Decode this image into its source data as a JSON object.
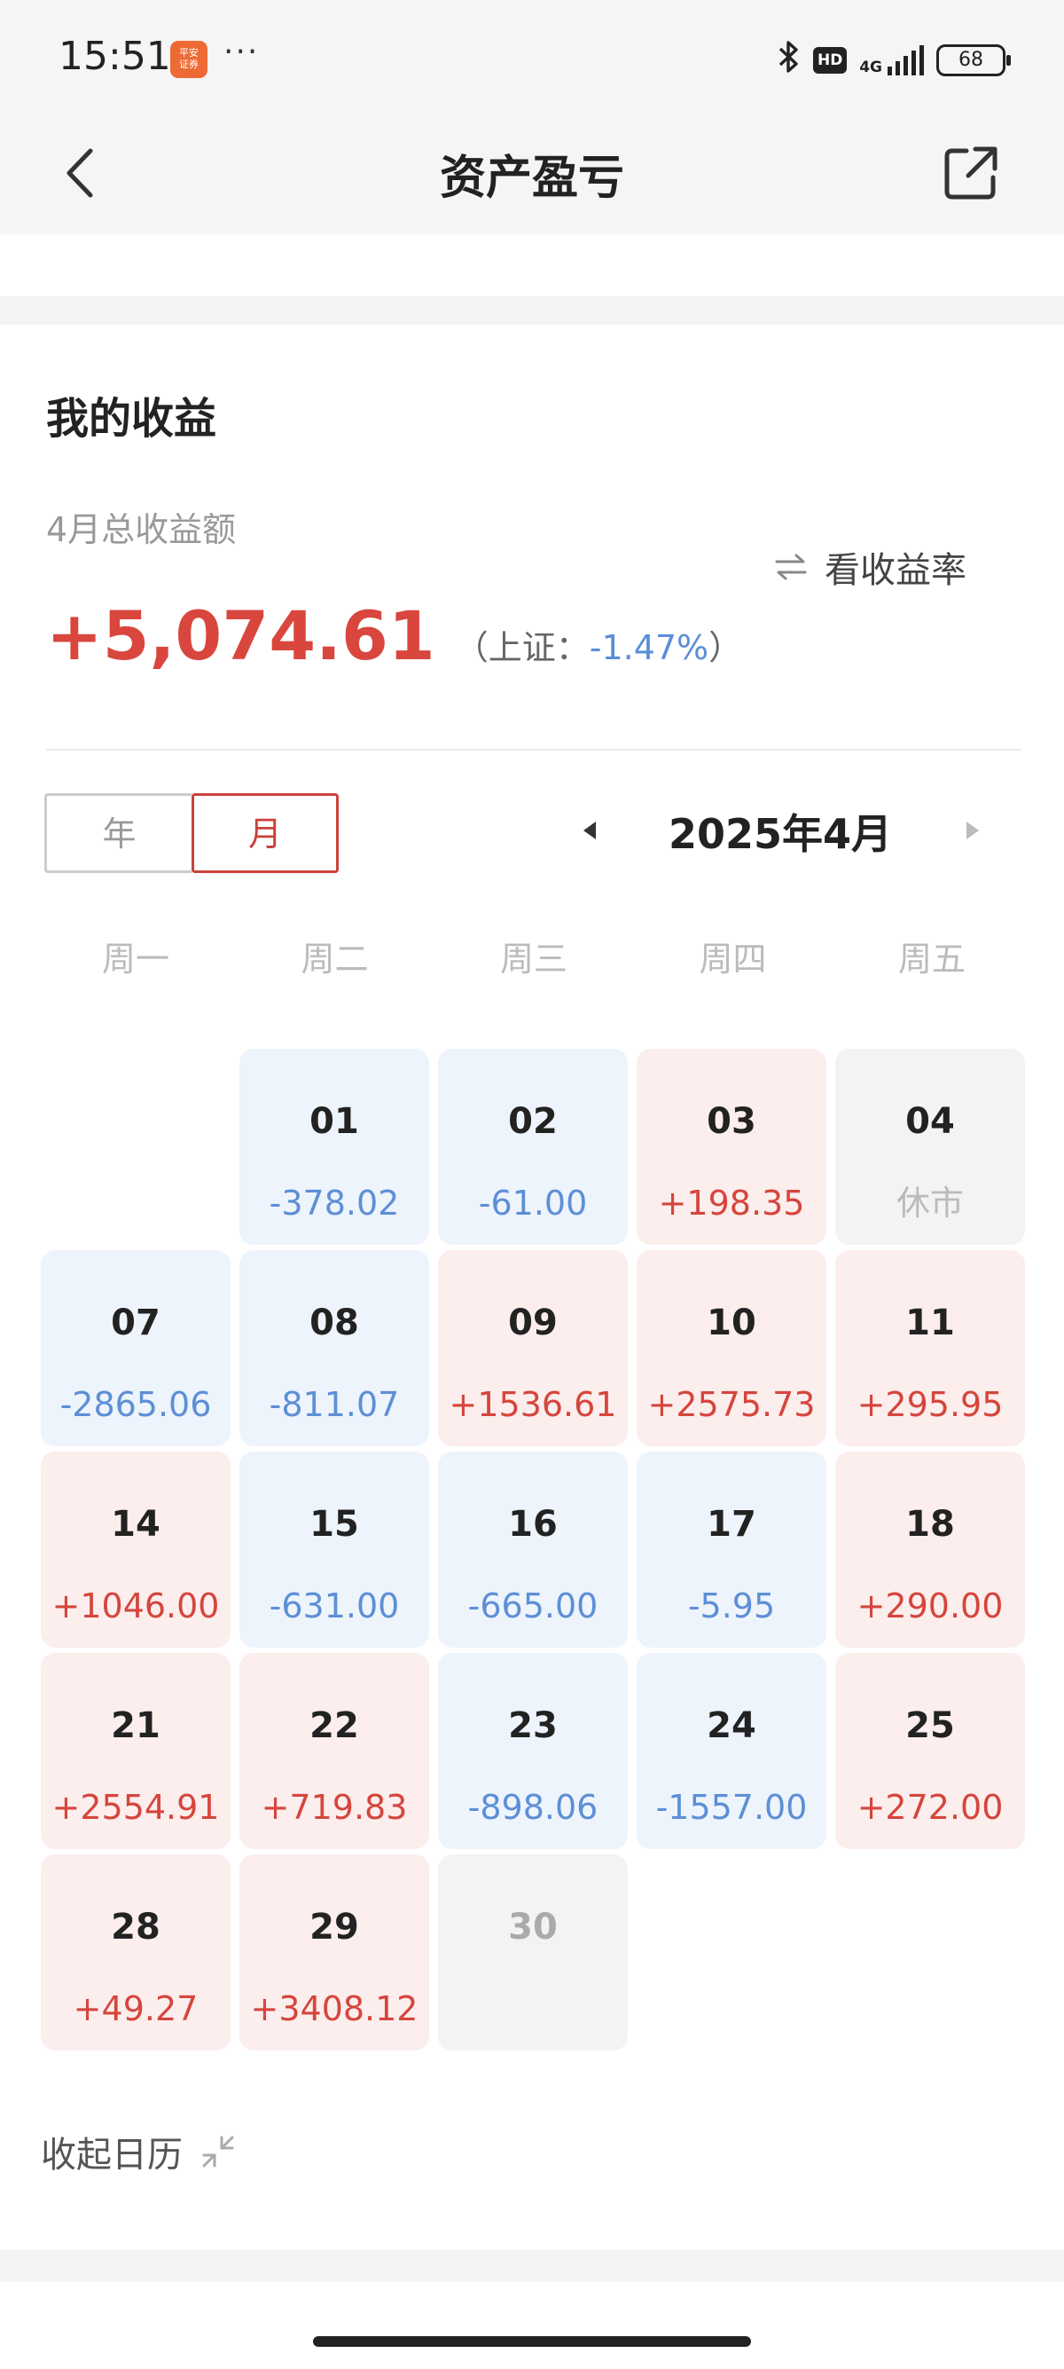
{
  "status_bar": {
    "time": "15:51",
    "app_badge_text": "平安证券",
    "more": "···",
    "bluetooth_icon": "bluetooth-icon",
    "hd_label": "HD",
    "network_label": "4G",
    "battery": "68"
  },
  "navbar": {
    "title": "资产盈亏",
    "back_icon": "chevron-left-icon",
    "share_icon": "share-external-icon"
  },
  "earnings": {
    "section_title": "我的收益",
    "total_label": "4月总收益额",
    "switch_icon": "swap-arrows-icon",
    "switch_label": "看收益率",
    "total_amount": "+5,074.61",
    "index_prefix": "（上证：",
    "index_change": "-1.47%",
    "index_suffix": "）"
  },
  "period_toggle": {
    "options": [
      "年",
      "月"
    ],
    "selected": "月"
  },
  "month_nav": {
    "label": "2025年4月",
    "prev_icon": "triangle-left-icon",
    "next_icon": "triangle-right-icon"
  },
  "weekdays": [
    "周一",
    "周二",
    "周三",
    "周四",
    "周五"
  ],
  "calendar": {
    "cells": [
      {
        "day": "",
        "value": "",
        "status": "empty"
      },
      {
        "day": "01",
        "value": "-378.02",
        "status": "neg"
      },
      {
        "day": "02",
        "value": "-61.00",
        "status": "neg"
      },
      {
        "day": "03",
        "value": "+198.35",
        "status": "pos"
      },
      {
        "day": "04",
        "value": "休市",
        "status": "closed"
      },
      {
        "day": "07",
        "value": "-2865.06",
        "status": "neg"
      },
      {
        "day": "08",
        "value": "-811.07",
        "status": "neg"
      },
      {
        "day": "09",
        "value": "+1536.61",
        "status": "pos"
      },
      {
        "day": "10",
        "value": "+2575.73",
        "status": "pos"
      },
      {
        "day": "11",
        "value": "+295.95",
        "status": "pos"
      },
      {
        "day": "14",
        "value": "+1046.00",
        "status": "pos"
      },
      {
        "day": "15",
        "value": "-631.00",
        "status": "neg"
      },
      {
        "day": "16",
        "value": "-665.00",
        "status": "neg"
      },
      {
        "day": "17",
        "value": "-5.95",
        "status": "neg"
      },
      {
        "day": "18",
        "value": "+290.00",
        "status": "pos"
      },
      {
        "day": "21",
        "value": "+2554.91",
        "status": "pos"
      },
      {
        "day": "22",
        "value": "+719.83",
        "status": "pos"
      },
      {
        "day": "23",
        "value": "-898.06",
        "status": "neg"
      },
      {
        "day": "24",
        "value": "-1557.00",
        "status": "neg"
      },
      {
        "day": "25",
        "value": "+272.00",
        "status": "pos"
      },
      {
        "day": "28",
        "value": "+49.27",
        "status": "pos"
      },
      {
        "day": "29",
        "value": "+3408.12",
        "status": "pos"
      },
      {
        "day": "30",
        "value": "",
        "status": "future"
      }
    ]
  },
  "collapse": {
    "label": "收起日历",
    "icon": "collapse-arrows-icon"
  },
  "colors": {
    "positive": "#d6453d",
    "negative": "#5d8fd6",
    "positive_bg": "#fbeeed",
    "negative_bg": "#eef4fc",
    "accent": "#c9423b"
  }
}
